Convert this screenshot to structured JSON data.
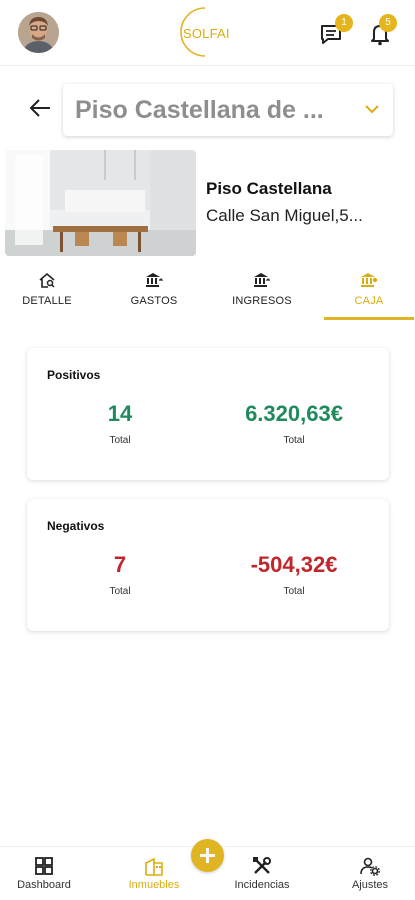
{
  "header": {
    "logo_text": "SOLFAI",
    "messages_badge": "1",
    "notifications_badge": "5",
    "accent": "#e0b423"
  },
  "property_selector": {
    "selected": "Piso Castellana de ..."
  },
  "property": {
    "name": "Piso Castellana",
    "address": "Calle San Miguel,5..."
  },
  "tabs": [
    {
      "label": "DETALLE",
      "icon": "house-search-icon",
      "active": false
    },
    {
      "label": "GASTOS",
      "icon": "bank-out-icon",
      "active": false
    },
    {
      "label": "INGRESOS",
      "icon": "bank-in-icon",
      "active": false
    },
    {
      "label": "CAJA",
      "icon": "bank-cash-icon",
      "active": true
    }
  ],
  "positivos": {
    "title": "Positivos",
    "count": "14",
    "count_label": "Total",
    "amount": "6.320,63€",
    "amount_label": "Total",
    "color": "#1f8a5b"
  },
  "negativos": {
    "title": "Negativos",
    "count": "7",
    "count_label": "Total",
    "amount": "-504,32€",
    "amount_label": "Total",
    "color": "#c0262b"
  },
  "bottom_nav": [
    {
      "label": "Dashboard",
      "icon": "dashboard-icon",
      "active": false
    },
    {
      "label": "Inmuebles",
      "icon": "building-icon",
      "active": true
    },
    {
      "label": "Incidencias",
      "icon": "tools-icon",
      "active": false
    },
    {
      "label": "Ajustes",
      "icon": "user-settings-icon",
      "active": false
    }
  ]
}
